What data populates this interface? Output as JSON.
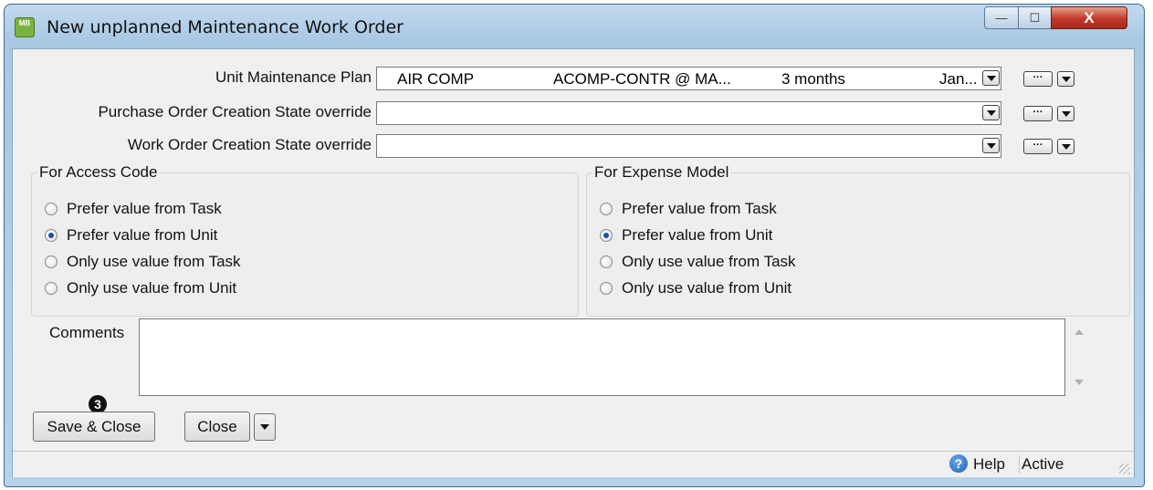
{
  "window": {
    "icon_text": "MB",
    "title": "New unplanned Maintenance Work Order",
    "min_glyph": "—",
    "max_glyph": "☐",
    "close_glyph": "X"
  },
  "fields": {
    "unit_plan": {
      "label": "Unit Maintenance Plan",
      "col1": "AIR COMP",
      "col2": "ACOMP-CONTR @ MA...",
      "col3": "3 months",
      "col4": "Jan..."
    },
    "po_state": {
      "label": "Purchase Order Creation State override",
      "value": ""
    },
    "wo_state": {
      "label": "Work Order Creation State override",
      "value": ""
    },
    "ellipsis": "···"
  },
  "access_code": {
    "title": "For Access Code",
    "options": [
      {
        "label": "Prefer value from Task",
        "selected": false
      },
      {
        "label": "Prefer value from Unit",
        "selected": true
      },
      {
        "label": "Only use value from Task",
        "selected": false
      },
      {
        "label": "Only use value from Unit",
        "selected": false
      }
    ]
  },
  "expense_model": {
    "title": "For Expense Model",
    "options": [
      {
        "label": "Prefer value from Task",
        "selected": false
      },
      {
        "label": "Prefer value from Unit",
        "selected": true
      },
      {
        "label": "Only use value from Task",
        "selected": false
      },
      {
        "label": "Only use value from Unit",
        "selected": false
      }
    ]
  },
  "comments": {
    "label": "Comments",
    "value": ""
  },
  "buttons": {
    "save_close": "Save & Close",
    "close": "Close",
    "marker": "3"
  },
  "status": {
    "help_glyph": "?",
    "help": "Help",
    "active": "Active"
  }
}
